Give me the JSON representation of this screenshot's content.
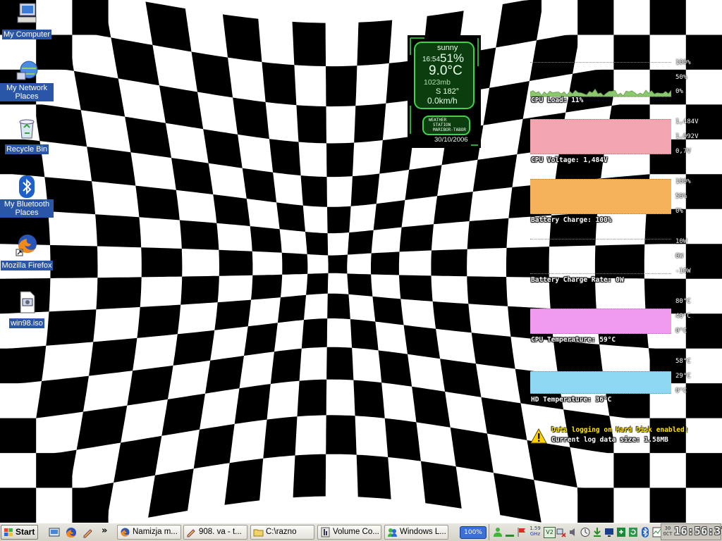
{
  "desktop_icons": [
    {
      "label": "My Computer",
      "icon": "my-computer-icon"
    },
    {
      "label": "My Network Places",
      "icon": "network-places-icon"
    },
    {
      "label": "Recycle Bin",
      "icon": "recycle-bin-icon"
    },
    {
      "label": "My Bluetooth Places",
      "icon": "bluetooth-icon"
    },
    {
      "label": "Mozilla Firefox",
      "icon": "firefox-icon"
    },
    {
      "label": "win98.iso",
      "icon": "iso-file-icon"
    }
  ],
  "weather": {
    "condition": "sunny",
    "time": "16:54",
    "humidity": "51%",
    "temperature": "9.0°C",
    "pressure": "1023mb",
    "wind_dir": "S 182°",
    "wind_speed": "0.0km/h",
    "station_line1": "WEATHER",
    "station_line2": "STATION",
    "station_line3": "MARIBOR-TABOR",
    "date": "30/10/2006"
  },
  "monitors": [
    {
      "caption": "CPU Load: 11%",
      "ticks": [
        "100%",
        "50%",
        "0%"
      ],
      "color": "#9ad07a",
      "level": 0.11
    },
    {
      "caption": "CPU Voltage: 1,484V",
      "ticks": [
        "1,484V",
        "1,092V",
        "0,7V"
      ],
      "color": "#f4a6b0",
      "level": 1.0
    },
    {
      "caption": "Battery Charge: 100%",
      "ticks": [
        "100%",
        "50%",
        "0%"
      ],
      "color": "#f6b25a",
      "level": 1.0
    },
    {
      "caption": "Battery Charge Rate: 0W",
      "ticks": [
        "10W",
        "0W",
        "-10W"
      ],
      "color": "#bbbbbb",
      "level": 0.5
    },
    {
      "caption": "CPU Temperature: 59°C",
      "ticks": [
        "80°C",
        "40°C",
        "0°C"
      ],
      "color": "#f09af0",
      "level": 0.74
    },
    {
      "caption": "HD Temperature: 36°C",
      "ticks": [
        "58°C",
        "29°C",
        "0°C"
      ],
      "color": "#8fd8f4",
      "level": 0.62
    }
  ],
  "log": {
    "line1": "Data logging on Hard Disk enabled!",
    "line2": "Current log data size: 1.58MB"
  },
  "taskbar": {
    "start_label": "Start",
    "more_label": "»",
    "buttons": [
      {
        "label": "Namizja m...",
        "icon": "firefox-icon"
      },
      {
        "label": "908. va - t...",
        "icon": "pencil-icon"
      },
      {
        "label": "C:\\razno",
        "icon": "folder-icon"
      },
      {
        "label": "Volume Co...",
        "icon": "volume-control-icon"
      },
      {
        "label": "Windows L...",
        "icon": "messenger-icon"
      }
    ],
    "battery_badge": "100%",
    "cpu_freq_line1": "1.59",
    "cpu_freq_line2": "GHz",
    "tray_v2_label": "V2",
    "clock_date_line1": "30",
    "clock_date_line2": "OCT",
    "clock_time": "16:56:37"
  },
  "colors": {
    "icon_label_bg": "#2a56a8",
    "log_warning": "#ffe000",
    "taskbar": "#d6d3c8"
  }
}
